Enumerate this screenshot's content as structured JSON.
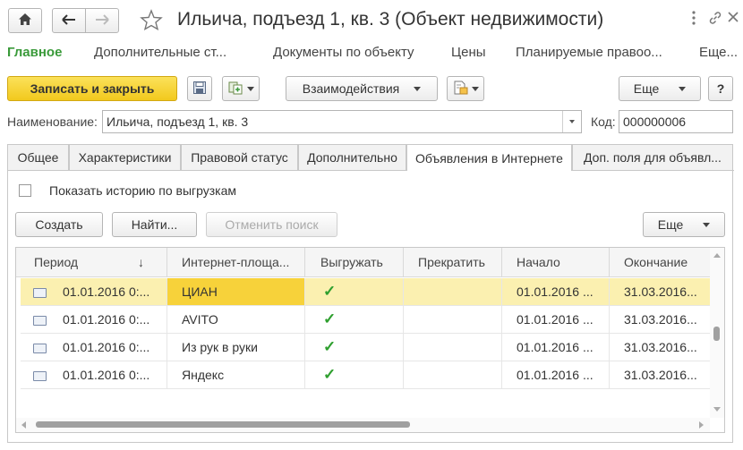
{
  "window": {
    "title": "Ильича, подъезд 1, кв. 3 (Объект недвижимости)"
  },
  "nav": {
    "items": [
      "Главное",
      "Дополнительные ст...",
      "Документы по объекту",
      "Цены",
      "Планируемые правоо...",
      "Еще..."
    ]
  },
  "toolbar": {
    "save_close": "Записать и закрыть",
    "interactions": "Взаимодействия",
    "more": "Еще",
    "help": "?"
  },
  "fields": {
    "name_label": "Наименование:",
    "name_value": "Ильича, подъезд 1, кв. 3",
    "code_label": "Код:",
    "code_value": "000000006"
  },
  "tabs": [
    "Общее",
    "Характеристики",
    "Правовой статус",
    "Дополнительно",
    "Объявления в Интернете",
    "Доп. поля для объявл..."
  ],
  "active_tab": "Объявления в Интернете",
  "history": {
    "label": "Показать историю по выгрузкам",
    "checked": false
  },
  "table_toolbar": {
    "create": "Создать",
    "find": "Найти...",
    "cancel_search": "Отменить поиск",
    "more": "Еще"
  },
  "table": {
    "columns": [
      "Период",
      "Интернет-площа...",
      "Выгружать",
      "Прекратить",
      "Начало",
      "Окончание"
    ],
    "sort_indicator": "↓",
    "rows": [
      {
        "period": "01.01.2016 0:...",
        "platform": "ЦИАН",
        "upload": "✓",
        "stop": "",
        "start": "01.01.2016 ...",
        "end": "31.03.2016..."
      },
      {
        "period": "01.01.2016 0:...",
        "platform": "AVITO",
        "upload": "✓",
        "stop": "",
        "start": "01.01.2016 ...",
        "end": "31.03.2016..."
      },
      {
        "period": "01.01.2016 0:...",
        "platform": "Из рук в руки",
        "upload": "✓",
        "stop": "",
        "start": "01.01.2016 ...",
        "end": "31.03.2016..."
      },
      {
        "period": "01.01.2016 0:...",
        "platform": "Яндекс",
        "upload": "✓",
        "stop": "",
        "start": "01.01.2016 ...",
        "end": "31.03.2016..."
      }
    ],
    "selected_row": 0
  },
  "colors": {
    "accent_green": "#3a9a3a",
    "primary_yellow": "#f5d02b",
    "selected_row": "#fbf0b0",
    "selected_cell": "#f7d23a",
    "check_green": "#2e9f2e"
  }
}
